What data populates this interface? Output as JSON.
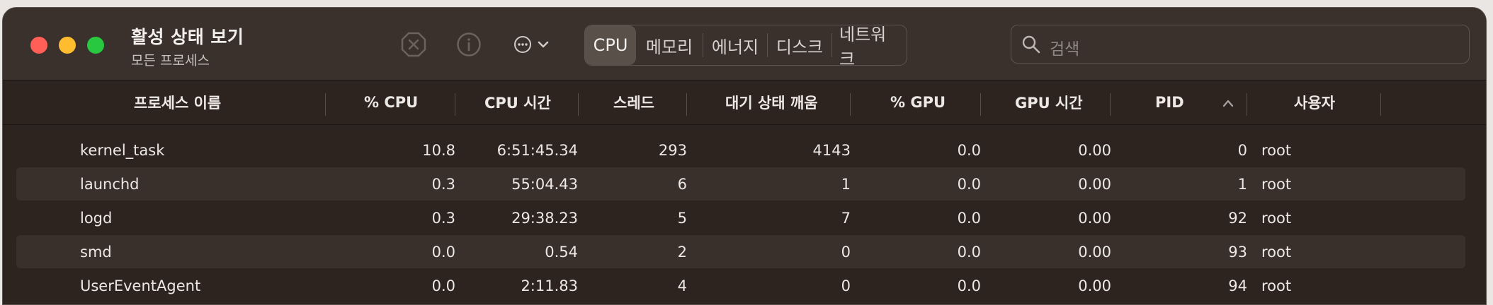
{
  "window": {
    "title": "활성 상태 보기",
    "subtitle": "모든 프로세스"
  },
  "toolbar": {
    "stop_icon": "x-octagon-icon",
    "info_icon": "info-circle-icon",
    "more_icon": "ellipsis-circle-icon",
    "tabs": [
      "CPU",
      "메모리",
      "에너지",
      "디스크",
      "네트워크"
    ],
    "active_tab": "CPU"
  },
  "search": {
    "placeholder": "검색"
  },
  "table": {
    "columns": [
      "프로세스 이름",
      "% CPU",
      "CPU 시간",
      "스레드",
      "대기 상태 깨움",
      "% GPU",
      "GPU 시간",
      "PID",
      "사용자"
    ],
    "sort_column": "PID",
    "sort_direction": "ascending",
    "rows": [
      [
        "kernel_task",
        "10.8",
        "6:51:45.34",
        "293",
        "4143",
        "0.0",
        "0.00",
        "0",
        "root"
      ],
      [
        "launchd",
        "0.3",
        "55:04.43",
        "6",
        "1",
        "0.0",
        "0.00",
        "1",
        "root"
      ],
      [
        "logd",
        "0.3",
        "29:38.23",
        "5",
        "7",
        "0.0",
        "0.00",
        "92",
        "root"
      ],
      [
        "smd",
        "0.0",
        "0.54",
        "2",
        "0",
        "0.0",
        "0.00",
        "93",
        "root"
      ],
      [
        "UserEventAgent",
        "0.0",
        "2:11.83",
        "4",
        "0",
        "0.0",
        "0.00",
        "94",
        "root"
      ]
    ]
  },
  "colors": {
    "close": "#ff5f57",
    "minimize": "#febc2e",
    "zoom": "#28c840",
    "background": "#2e241f",
    "titlebar": "#3a312c"
  }
}
